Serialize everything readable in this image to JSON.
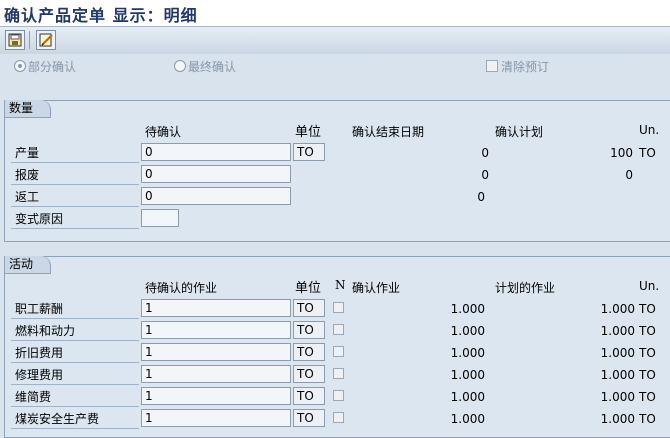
{
  "window": {
    "title": "确认产品定单 显示：明细"
  },
  "toolbar": {
    "buttons": [
      "save-icon",
      "edit-icon"
    ]
  },
  "options": {
    "partial": "部分确认",
    "final": "最终确认",
    "clear_reservation": "清除预订",
    "selected": "partial"
  },
  "quantity": {
    "title": "数量",
    "headers": {
      "pending": "待确认",
      "unit": "单位",
      "end_date": "确认结束日期",
      "plan": "确认计划",
      "un": "Un."
    },
    "rows": [
      {
        "label": "产量",
        "value": "0",
        "unit": "TO",
        "confirmed": "0",
        "plan": "100",
        "un": "TO"
      },
      {
        "label": "报废",
        "value": "0",
        "confirmed": "0",
        "plan": "0"
      },
      {
        "label": "返工",
        "value": "0",
        "confirmed": "0"
      },
      {
        "label": "变式原因",
        "value": ""
      }
    ]
  },
  "activities": {
    "title": "活动",
    "headers": {
      "pending": "待确认的作业",
      "unit": "单位",
      "n": "N",
      "confirmed": "确认作业",
      "plan": "计划的作业",
      "un": "Un."
    },
    "rows": [
      {
        "label": "职工薪酬",
        "value": "1",
        "unit": "TO",
        "confirmed": "1.000",
        "plan": "1.000",
        "un": "TO"
      },
      {
        "label": "燃料和动力",
        "value": "1",
        "unit": "TO",
        "confirmed": "1.000",
        "plan": "1.000",
        "un": "TO"
      },
      {
        "label": "折旧费用",
        "value": "1",
        "unit": "TO",
        "confirmed": "1.000",
        "plan": "1.000",
        "un": "TO"
      },
      {
        "label": "修理费用",
        "value": "1",
        "unit": "TO",
        "confirmed": "1.000",
        "plan": "1.000",
        "un": "TO"
      },
      {
        "label": "维简费",
        "value": "1",
        "unit": "TO",
        "confirmed": "1.000",
        "plan": "1.000",
        "un": "TO"
      },
      {
        "label": "煤炭安全生产费",
        "value": "1",
        "unit": "TO",
        "confirmed": "1.000",
        "plan": "1.000",
        "un": "TO"
      }
    ]
  }
}
